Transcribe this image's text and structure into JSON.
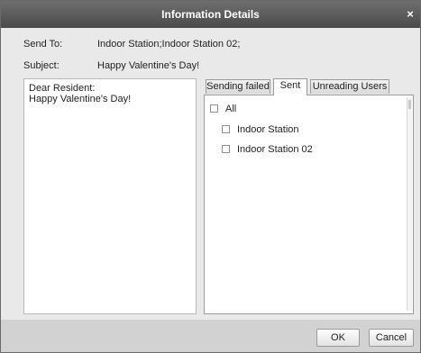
{
  "dialog": {
    "title": "Information Details",
    "close_glyph": "×"
  },
  "send_to": {
    "label": "Send To:",
    "value": "Indoor Station;Indoor Station 02;"
  },
  "subject": {
    "label": "Subject:",
    "value": "Happy Valentine's Day!"
  },
  "message": {
    "line1": "Dear Resident:",
    "line2": "Happy Valentine's Day!"
  },
  "tabs": [
    {
      "label": "Sending failed",
      "selected": false
    },
    {
      "label": "Sent",
      "selected": true
    },
    {
      "label": "Unreading Users",
      "selected": false
    }
  ],
  "recipients": {
    "all_label": "All",
    "items": [
      {
        "label": "Indoor Station",
        "checked": false
      },
      {
        "label": "Indoor Station 02",
        "checked": false
      }
    ]
  },
  "buttons": {
    "ok": "OK",
    "cancel": "Cancel"
  },
  "colors": {
    "titlebar": "#555555",
    "dialog_bg": "#e9e9e9",
    "footer_bg": "#d2d2d2"
  }
}
